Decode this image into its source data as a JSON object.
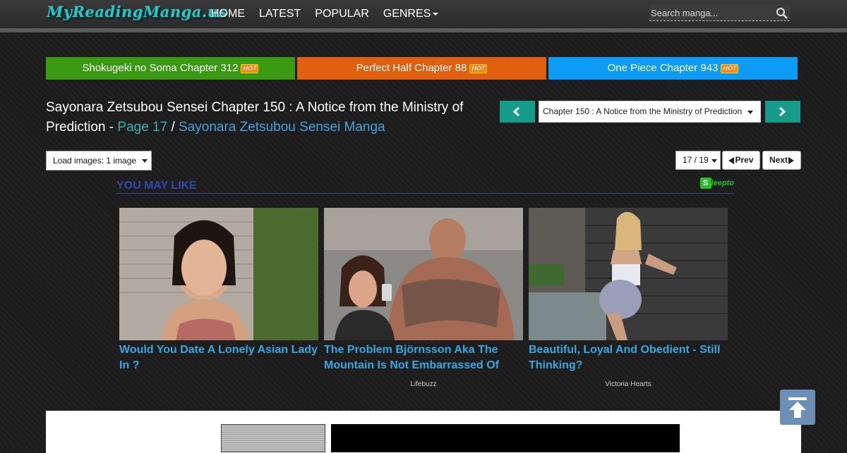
{
  "header": {
    "logo_text": "MyReadingManga.us",
    "nav": [
      {
        "label": "HOME"
      },
      {
        "label": "LATEST"
      },
      {
        "label": "POPULAR"
      },
      {
        "label": "GENRES"
      }
    ],
    "search_placeholder": "Search manga..."
  },
  "hot_links": [
    {
      "label": "Shokugeki no Soma Chapter 312",
      "badge": "HOT",
      "color": "#3a9a13"
    },
    {
      "label": "Perfect Half Chapter 88",
      "badge": "HOT",
      "color": "#e06010"
    },
    {
      "label": "One Piece Chapter 943",
      "badge": "HOT",
      "color": "#0d9cf5"
    }
  ],
  "title": {
    "chapter": "Sayonara Zetsubou Sensei Chapter 150 : A Notice from the Ministry of Prediction",
    "dash": "-",
    "page_link": "Page 17",
    "slash": "/",
    "manga_link": "Sayonara Zetsubou Sensei Manga"
  },
  "chapter_select": {
    "selected": "Chapter 150 : A Notice from the Ministry of Prediction"
  },
  "load_select": {
    "selected": "Load images: 1 image"
  },
  "pager": {
    "page_select": "17 / 19",
    "prev": "Prev",
    "next": "Next"
  },
  "recommend": {
    "heading": "YOU MAY LIKE",
    "brand": "leepto",
    "brand_mark": "S",
    "cards": [
      {
        "title": "Would You Date A Lonely Asian Lady In ?",
        "source": ""
      },
      {
        "title": "The Problem Björnsson Aka The Mountain Is Not Embarrassed Of",
        "source": "Lifebuzz"
      },
      {
        "title": "Beautiful, Loyal And Obedient - Still Thinking?",
        "source": "Victoria Hearts"
      }
    ]
  },
  "colors": {
    "accent_teal": "#169b8a",
    "link_blue": "#3aa8e0"
  }
}
